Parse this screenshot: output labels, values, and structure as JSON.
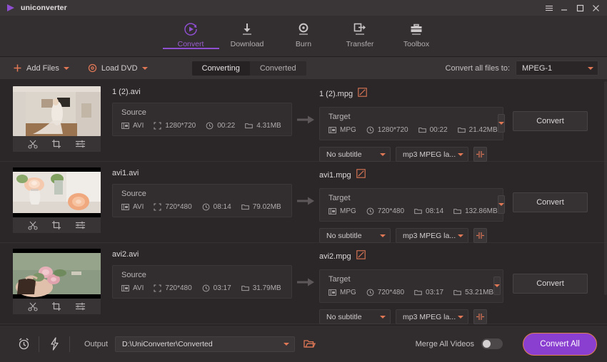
{
  "window": {
    "app_title": "uniconverter",
    "logo_icon": "play-triangle-icon",
    "controls": [
      {
        "name": "menu-button",
        "icon": "hamburger-menu-icon",
        "glyph": "≡"
      },
      {
        "name": "minimize-button",
        "icon": "minimize-icon",
        "glyph": "—"
      },
      {
        "name": "maximize-button",
        "icon": "maximize-icon",
        "glyph": "☐"
      },
      {
        "name": "close-button",
        "icon": "close-icon",
        "glyph": "✕"
      }
    ]
  },
  "nav": {
    "active": "Convert",
    "accent_color": "#8e4fd0",
    "items": [
      {
        "label": "Convert",
        "icon": "convert-refresh-play-icon",
        "active": true
      },
      {
        "label": "Download",
        "icon": "download-arrow-icon",
        "active": false
      },
      {
        "label": "Burn",
        "icon": "burn-disc-icon",
        "active": false
      },
      {
        "label": "Transfer",
        "icon": "transfer-device-icon",
        "active": false
      },
      {
        "label": "Toolbox",
        "icon": "toolbox-icon",
        "active": false
      }
    ]
  },
  "toolbar": {
    "add_files_label": "Add Files",
    "add_files_icon": "plus-icon",
    "load_dvd_label": "Load DVD",
    "load_dvd_icon": "disc-icon",
    "tabs": [
      {
        "label": "Converting",
        "active": true
      },
      {
        "label": "Converted",
        "active": false
      }
    ],
    "convert_all_to_label": "Convert all files to:",
    "format_value": "MPEG-1",
    "accent_color": "#e07856"
  },
  "rows": [
    {
      "thumbnail": "bride-in-wedding-dress-thumbnail",
      "tools": [
        {
          "name": "trim-icon",
          "title": "Trim"
        },
        {
          "name": "crop-icon",
          "title": "Crop"
        },
        {
          "name": "effect-icon",
          "title": "Effect"
        }
      ],
      "source": {
        "filename": "1 (2).avi",
        "section_label": "Source",
        "format": "AVI",
        "resolution": "1280*720",
        "duration": "00:22",
        "size": "4.31MB"
      },
      "target": {
        "filename": "1 (2).mpg",
        "edit_icon": "edit-pencil-icon",
        "section_label": "Target",
        "format": "MPG",
        "resolution": "1280*720",
        "duration": "00:22",
        "size": "21.42MB",
        "preset_icon": "chevron-down-icon",
        "convert_label": "Convert",
        "subtitle_value": "No subtitle",
        "audio_value": "mp3 MPEG la...",
        "add_track_icon": "add-audio-track-icon"
      }
    },
    {
      "thumbnail": "peach-roses-in-vase-thumbnail",
      "tools": [
        {
          "name": "trim-icon",
          "title": "Trim"
        },
        {
          "name": "crop-icon",
          "title": "Crop"
        },
        {
          "name": "effect-icon",
          "title": "Effect"
        }
      ],
      "source": {
        "filename": "avi1.avi",
        "section_label": "Source",
        "format": "AVI",
        "resolution": "720*480",
        "duration": "08:14",
        "size": "79.02MB"
      },
      "target": {
        "filename": "avi1.mpg",
        "edit_icon": "edit-pencil-icon",
        "section_label": "Target",
        "format": "MPG",
        "resolution": "720*480",
        "duration": "08:14",
        "size": "132.86MB",
        "preset_icon": "chevron-down-icon",
        "convert_label": "Convert",
        "subtitle_value": "No subtitle",
        "audio_value": "mp3 MPEG la...",
        "add_track_icon": "add-audio-track-icon"
      }
    },
    {
      "thumbnail": "woman-with-pink-roses-thumbnail",
      "tools": [
        {
          "name": "trim-icon",
          "title": "Trim"
        },
        {
          "name": "crop-icon",
          "title": "Crop"
        },
        {
          "name": "effect-icon",
          "title": "Effect"
        }
      ],
      "source": {
        "filename": "avi2.avi",
        "section_label": "Source",
        "format": "AVI",
        "resolution": "720*480",
        "duration": "03:17",
        "size": "31.79MB"
      },
      "target": {
        "filename": "avi2.mpg",
        "edit_icon": "edit-pencil-icon",
        "section_label": "Target",
        "format": "MPG",
        "resolution": "720*480",
        "duration": "03:17",
        "size": "53.21MB",
        "preset_icon": "chevron-down-icon",
        "convert_label": "Convert",
        "subtitle_value": "No subtitle",
        "audio_value": "mp3 MPEG la...",
        "add_track_icon": "add-audio-track-icon"
      }
    }
  ],
  "bottom": {
    "alarm_icon": "alarm-clock-icon",
    "speed_icon": "lightning-bolt-icon",
    "output_label": "Output",
    "output_path": "D:\\UniConverter\\Converted",
    "folder_icon": "open-folder-icon",
    "merge_label": "Merge All Videos",
    "merge_enabled": false,
    "convert_all_label": "Convert All",
    "convert_all_bg": "#8a3fd0",
    "convert_all_border": "#e08050"
  }
}
